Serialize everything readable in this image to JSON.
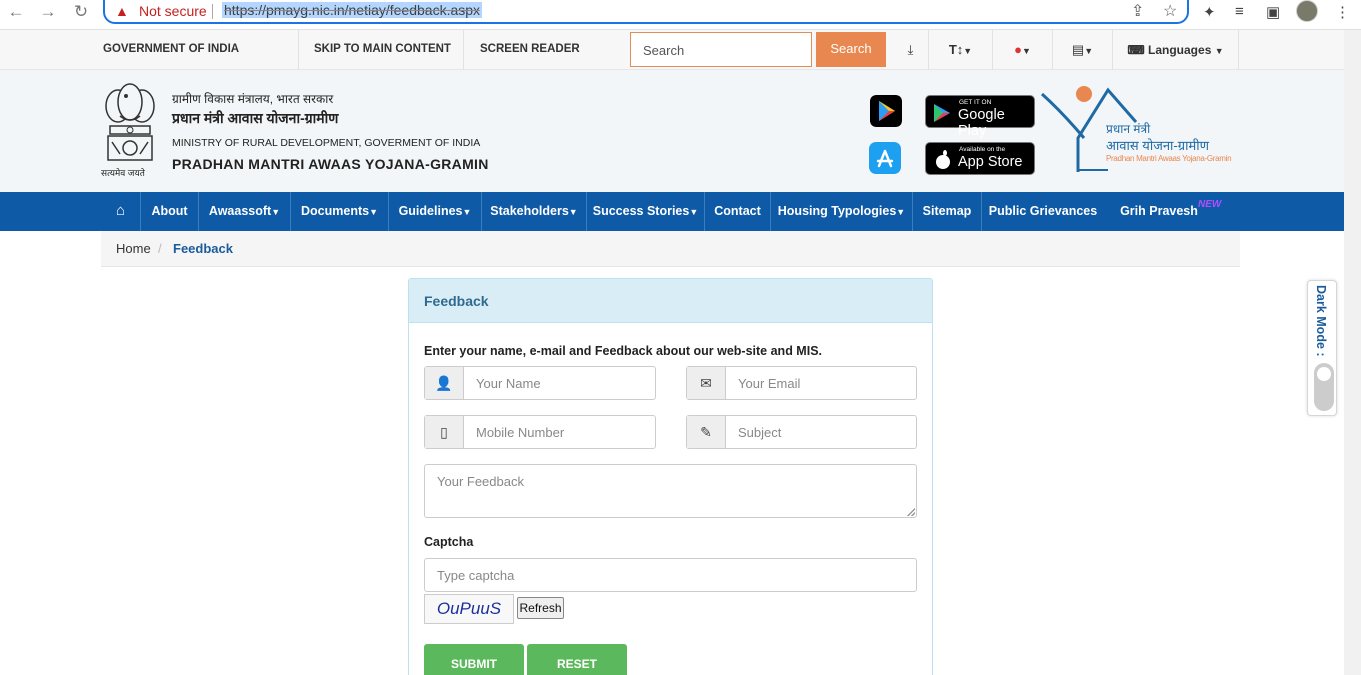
{
  "browser": {
    "security_label": "Not secure",
    "url": "https://pmayg.nic.in/netiay/feedback.aspx"
  },
  "topbar": {
    "gov_label": "GOVERNMENT OF INDIA",
    "skip_label": "SKIP TO MAIN CONTENT",
    "screen_reader_label": "SCREEN READER ACCESS",
    "search_placeholder": "Search",
    "search_button": "Search",
    "text_size_label": "T↕",
    "languages_label": "Languages"
  },
  "header": {
    "emblem_caption": "सत्यमेव जयते",
    "ministry_hindi": "ग्रामीण विकास मंत्रालय, भारत सरकार",
    "scheme_hindi": "प्रधान मंत्री आवास योजना-ग्रामीण",
    "ministry_english": "MINISTRY OF RURAL DEVELOPMENT, GOVERMENT OF INDIA",
    "scheme_english": "PRADHAN MANTRI AWAAS YOJANA-GRAMIN",
    "google_play_small": "GET IT ON",
    "google_play_big": "Google Play",
    "app_store_small": "Available on the",
    "app_store_big": "App Store",
    "logo_line1": "प्रधान मंत्री",
    "logo_line2": "आवास योजना-ग्रामीण",
    "logo_line3": "Pradhan Mantri Awaas Yojana-Gramin"
  },
  "nav": {
    "items": [
      "About",
      "Awaassoft",
      "Documents",
      "Guidelines",
      "Stakeholders",
      "Success Stories",
      "Contact",
      "Housing Typologies",
      "Sitemap",
      "Public Grievances",
      "Grih Pravesh"
    ],
    "new_badge": "NEW"
  },
  "breadcrumb": {
    "home": "Home",
    "separator": "/",
    "current": "Feedback"
  },
  "form": {
    "title": "Feedback",
    "intro": "Enter your name, e-mail and Feedback about our web-site and MIS.",
    "name_placeholder": "Your Name",
    "email_placeholder": "Your Email",
    "mobile_placeholder": "Mobile Number",
    "subject_placeholder": "Subject",
    "feedback_placeholder": "Your Feedback",
    "captcha_label": "Captcha",
    "captcha_placeholder": "Type captcha",
    "captcha_text": "OuPuuS",
    "refresh_label": "Refresh",
    "submit_label": "SUBMIT",
    "reset_label": "RESET"
  },
  "dark_mode": {
    "label": "Dark Mode :"
  },
  "colors": {
    "nav_blue": "#0e5aa7",
    "accent_orange": "#e8874f",
    "button_green": "#5cb85c",
    "panel_head": "#d9edf7"
  }
}
